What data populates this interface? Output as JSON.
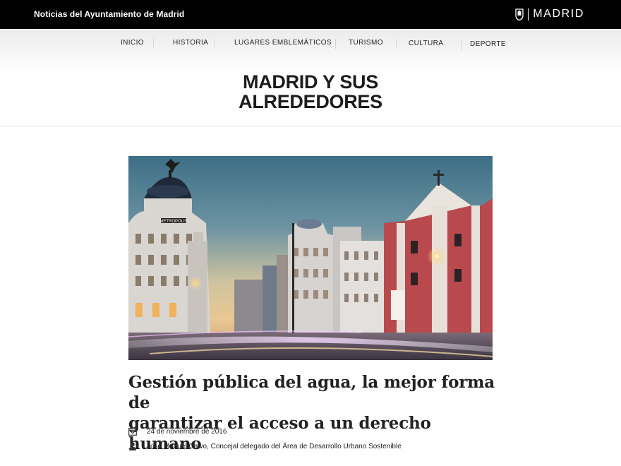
{
  "header": {
    "site_title": "Noticias del Ayuntamiento de Madrid",
    "brand": "MADRID",
    "brand_icon": "madrid-crest-icon"
  },
  "nav": {
    "items": [
      {
        "label": "INICIO"
      },
      {
        "label": "HISTORIA"
      },
      {
        "label": "LUGARES EMBLEMÁTICOS"
      },
      {
        "label": "TURISMO"
      },
      {
        "label": "CULTURA"
      },
      {
        "label": "DEPORTE"
      }
    ]
  },
  "section": {
    "title_line1": "MADRID Y SUS",
    "title_line2": "ALREDEDORES"
  },
  "hero": {
    "building_sign": "METROPOLIS"
  },
  "article": {
    "headline_line1": "Gestión pública del agua, la mejor forma de",
    "headline_line2": "garantizar el acceso a un derecho humano",
    "date": "24 de noviembre de 2016",
    "date_icon": "calendar-icon",
    "author": "José Manuel Calvo, Concejal delegado del Área de Desarrollo Urbano Sostenible",
    "author_icon": "user-icon"
  },
  "colors": {
    "topbar_bg": "#000000",
    "text": "#222222",
    "divider": "#e2e2e2"
  }
}
